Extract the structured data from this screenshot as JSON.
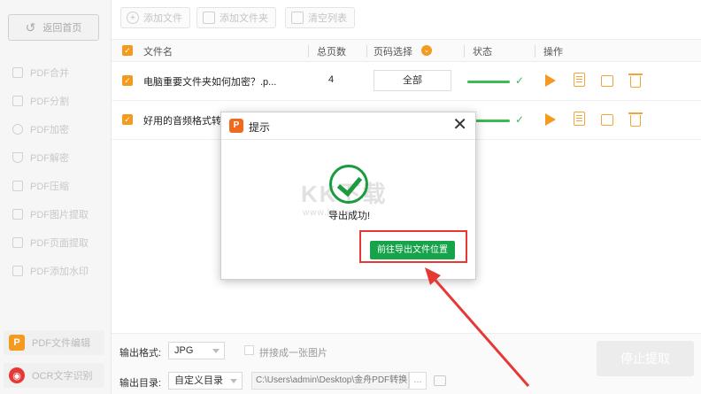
{
  "sidebar": {
    "back_label": "返回首页",
    "items": [
      {
        "label": "PDF合并"
      },
      {
        "label": "PDF分割"
      },
      {
        "label": "PDF加密"
      },
      {
        "label": "PDF解密"
      },
      {
        "label": "PDF压缩"
      },
      {
        "label": "PDF图片提取"
      },
      {
        "label": "PDF页面提取"
      },
      {
        "label": "PDF添加水印"
      }
    ],
    "bottom": [
      {
        "label": "PDF文件编辑",
        "icon": "P",
        "color": "#f39a1f"
      },
      {
        "label": "OCR文字识别",
        "icon": "eye",
        "color": "#e53935"
      }
    ]
  },
  "toolbar": {
    "add_file": "添加文件",
    "add_folder": "添加文件夹",
    "clear_list": "清空列表"
  },
  "table": {
    "headers": {
      "name": "文件名",
      "pages": "总页数",
      "range": "页码选择",
      "status": "状态",
      "ops": "操作"
    },
    "rows": [
      {
        "name": "电脑重要文件夹如何加密？.p...",
        "pages": "4",
        "range": "全部"
      },
      {
        "name": "好用的音频格式转",
        "pages": "",
        "range": ""
      }
    ]
  },
  "bottom": {
    "format_label": "输出格式:",
    "format_value": "JPG",
    "merge_label": "拼接成一张图片",
    "dir_label": "输出目录:",
    "dir_value": "自定义目录",
    "path": "C:\\Users\\admin\\Desktop\\金舟PDF转换",
    "dots": "...",
    "stop_label": "停止提取"
  },
  "dialog": {
    "title": "提示",
    "close": "✕",
    "message": "导出成功!",
    "goto_button": "前往导出文件位置",
    "watermark": "KK下载",
    "watermark_url": "www.kkx.net"
  },
  "colors": {
    "accent": "#f39a1f",
    "success": "#1c9a3e",
    "button_green": "#16a34a",
    "annotation_red": "#e53935"
  }
}
